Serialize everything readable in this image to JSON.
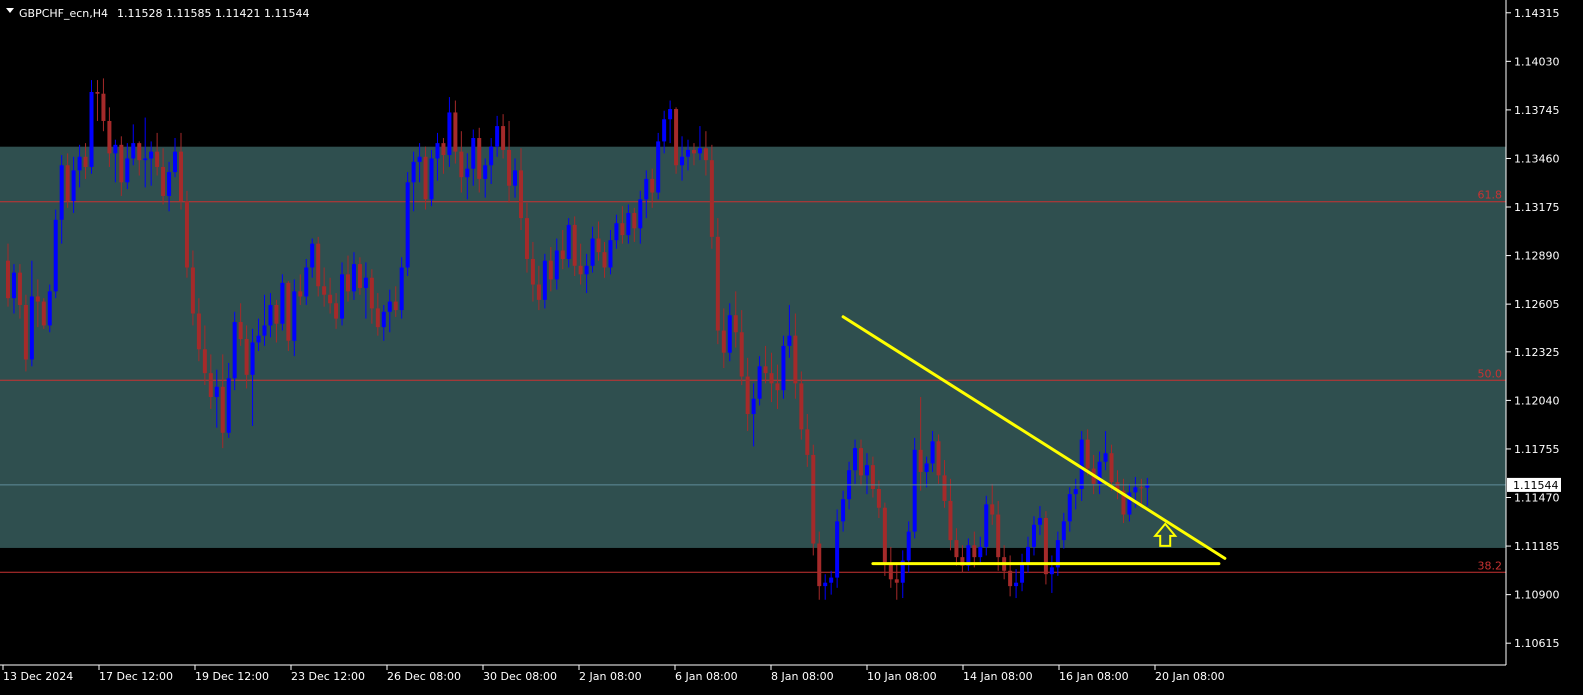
{
  "header": {
    "symbol": "GBPCHF_ecn,H4",
    "ohlc": "1.11528 1.11585 1.11421 1.11544"
  },
  "chart_data": {
    "type": "candlestick",
    "symbol": "GBPCHF_ecn",
    "timeframe": "H4",
    "ohlc_readout": {
      "open": 1.11528,
      "high": 1.11585,
      "low": 1.11421,
      "close": 1.11544
    },
    "current_price": 1.11544,
    "current_price_label": "1.11544",
    "y_range": [
      1.10487,
      1.1439
    ],
    "y_ticks": [
      "1.14315",
      "1.14030",
      "1.13745",
      "1.13460",
      "1.13175",
      "1.12890",
      "1.12605",
      "1.12325",
      "1.12040",
      "1.11755",
      "1.11470",
      "1.11185",
      "1.10900",
      "1.10615"
    ],
    "x_ticks": [
      "13 Dec 2024",
      "17 Dec 12:00",
      "19 Dec 12:00",
      "23 Dec 12:00",
      "26 Dec 08:00",
      "30 Dec 08:00",
      "2 Jan 08:00",
      "6 Jan 08:00",
      "8 Jan 08:00",
      "10 Jan 08:00",
      "14 Jan 08:00",
      "16 Jan 08:00",
      "20 Jan 08:00"
    ],
    "fibonacci_levels": [
      {
        "label": "61.8",
        "price": 1.13206
      },
      {
        "label": "50.0",
        "price": 1.12158
      },
      {
        "label": "38.2",
        "price": 1.11031
      }
    ],
    "shaded_zone": {
      "top": 1.13529,
      "bottom": 1.11174,
      "color": "#2f4f4f"
    },
    "trendlines": [
      {
        "name": "descending resistance",
        "from_bar": 140,
        "from_price": 1.12531,
        "to_bar": 204,
        "to_price": 1.11113,
        "color": "#ffff00"
      },
      {
        "name": "horizontal support",
        "from_bar": 145,
        "from_price": 1.11082,
        "to_bar": 203,
        "to_price": 1.11082,
        "color": "#ffff00"
      }
    ],
    "arrow_marker": {
      "bar": 194,
      "price": 1.11186,
      "direction": "up",
      "color": "#ffff00"
    },
    "colors": {
      "bull": "#0000ff",
      "bear": "#a52a2a",
      "background": "#000000",
      "axis": "#ffffff",
      "fib": "#c83232",
      "current_price_line": "#5f8c9a"
    },
    "candles": [
      [
        1.1286,
        1.1296,
        1.1259,
        1.1264
      ],
      [
        1.1264,
        1.1284,
        1.1255,
        1.1279
      ],
      [
        1.1279,
        1.1284,
        1.1252,
        1.126
      ],
      [
        1.126,
        1.1266,
        1.1221,
        1.1228
      ],
      [
        1.1228,
        1.1286,
        1.1224,
        1.1265
      ],
      [
        1.1265,
        1.1275,
        1.1247,
        1.1262
      ],
      [
        1.1262,
        1.1264,
        1.1246,
        1.1248
      ],
      [
        1.1248,
        1.1272,
        1.1244,
        1.1268
      ],
      [
        1.1268,
        1.1316,
        1.1264,
        1.131
      ],
      [
        1.131,
        1.1348,
        1.1296,
        1.1342
      ],
      [
        1.1342,
        1.1349,
        1.1317,
        1.1321
      ],
      [
        1.1321,
        1.1347,
        1.1314,
        1.1339
      ],
      [
        1.1339,
        1.1354,
        1.1329,
        1.1347
      ],
      [
        1.1347,
        1.1355,
        1.1334,
        1.1341
      ],
      [
        1.1341,
        1.1392,
        1.1337,
        1.1385
      ],
      [
        1.1385,
        1.1392,
        1.1368,
        1.1384
      ],
      [
        1.1384,
        1.1393,
        1.1362,
        1.1368
      ],
      [
        1.1368,
        1.1376,
        1.1341,
        1.1349
      ],
      [
        1.1349,
        1.1357,
        1.1332,
        1.1354
      ],
      [
        1.1354,
        1.1359,
        1.1324,
        1.1332
      ],
      [
        1.1332,
        1.1355,
        1.1328,
        1.1346
      ],
      [
        1.1346,
        1.1366,
        1.1342,
        1.1355
      ],
      [
        1.1355,
        1.1356,
        1.1336,
        1.1345
      ],
      [
        1.1345,
        1.137,
        1.1329,
        1.1346
      ],
      [
        1.1346,
        1.1356,
        1.133,
        1.135
      ],
      [
        1.135,
        1.1361,
        1.1336,
        1.1341
      ],
      [
        1.1341,
        1.1352,
        1.1319,
        1.1324
      ],
      [
        1.1324,
        1.1344,
        1.1315,
        1.1338
      ],
      [
        1.1338,
        1.1358,
        1.1335,
        1.135
      ],
      [
        1.135,
        1.1361,
        1.1316,
        1.1321
      ],
      [
        1.1321,
        1.1327,
        1.1276,
        1.1282
      ],
      [
        1.1282,
        1.1292,
        1.1248,
        1.1255
      ],
      [
        1.1255,
        1.1264,
        1.1227,
        1.1234
      ],
      [
        1.1234,
        1.1248,
        1.1213,
        1.122
      ],
      [
        1.122,
        1.1231,
        1.1199,
        1.1206
      ],
      [
        1.1206,
        1.1222,
        1.1188,
        1.1212
      ],
      [
        1.1212,
        1.1231,
        1.1176,
        1.1185
      ],
      [
        1.1185,
        1.1226,
        1.1182,
        1.1217
      ],
      [
        1.1217,
        1.1256,
        1.121,
        1.125
      ],
      [
        1.125,
        1.1261,
        1.1236,
        1.124
      ],
      [
        1.124,
        1.1248,
        1.1211,
        1.1219
      ],
      [
        1.1219,
        1.1246,
        1.1189,
        1.1238
      ],
      [
        1.1238,
        1.1252,
        1.1233,
        1.1242
      ],
      [
        1.1242,
        1.1266,
        1.1236,
        1.1248
      ],
      [
        1.1248,
        1.1267,
        1.1241,
        1.126
      ],
      [
        1.126,
        1.1263,
        1.1238,
        1.1249
      ],
      [
        1.1249,
        1.1278,
        1.1245,
        1.1273
      ],
      [
        1.1273,
        1.1274,
        1.1233,
        1.1239
      ],
      [
        1.1239,
        1.1275,
        1.123,
        1.1268
      ],
      [
        1.1268,
        1.1278,
        1.126,
        1.1265
      ],
      [
        1.1265,
        1.1287,
        1.126,
        1.1282
      ],
      [
        1.1282,
        1.1299,
        1.1276,
        1.1296
      ],
      [
        1.1296,
        1.13,
        1.1265,
        1.1271
      ],
      [
        1.1271,
        1.1282,
        1.1259,
        1.1266
      ],
      [
        1.1266,
        1.1276,
        1.1255,
        1.1261
      ],
      [
        1.1261,
        1.1267,
        1.1246,
        1.1252
      ],
      [
        1.1252,
        1.1285,
        1.1248,
        1.1278
      ],
      [
        1.1278,
        1.1289,
        1.1262,
        1.1268
      ],
      [
        1.1268,
        1.1291,
        1.1263,
        1.1284
      ],
      [
        1.1284,
        1.1288,
        1.1266,
        1.127
      ],
      [
        1.127,
        1.1285,
        1.1252,
        1.1276
      ],
      [
        1.1276,
        1.1281,
        1.1249,
        1.1258
      ],
      [
        1.1258,
        1.1267,
        1.1242,
        1.1247
      ],
      [
        1.1247,
        1.126,
        1.1239,
        1.1256
      ],
      [
        1.1256,
        1.1269,
        1.1244,
        1.1262
      ],
      [
        1.1262,
        1.1271,
        1.1253,
        1.1257
      ],
      [
        1.1257,
        1.1288,
        1.1252,
        1.1282
      ],
      [
        1.1282,
        1.1338,
        1.1277,
        1.1332
      ],
      [
        1.1332,
        1.135,
        1.1315,
        1.1344
      ],
      [
        1.1344,
        1.1355,
        1.1332,
        1.1347
      ],
      [
        1.1347,
        1.1353,
        1.1316,
        1.1322
      ],
      [
        1.1322,
        1.1351,
        1.1318,
        1.1346
      ],
      [
        1.1346,
        1.1361,
        1.1333,
        1.1355
      ],
      [
        1.1355,
        1.1358,
        1.1337,
        1.1348
      ],
      [
        1.1348,
        1.1382,
        1.1341,
        1.1373
      ],
      [
        1.1373,
        1.138,
        1.1343,
        1.135
      ],
      [
        1.135,
        1.1362,
        1.1326,
        1.1335
      ],
      [
        1.1335,
        1.1349,
        1.1322,
        1.134
      ],
      [
        1.134,
        1.1363,
        1.133,
        1.1358
      ],
      [
        1.1358,
        1.1364,
        1.1326,
        1.1334
      ],
      [
        1.1334,
        1.1346,
        1.1323,
        1.1342
      ],
      [
        1.1342,
        1.1358,
        1.1331,
        1.1353
      ],
      [
        1.1353,
        1.1371,
        1.1347,
        1.1365
      ],
      [
        1.1365,
        1.1372,
        1.1346,
        1.1351
      ],
      [
        1.1351,
        1.1368,
        1.132,
        1.133
      ],
      [
        1.133,
        1.1346,
        1.1323,
        1.1339
      ],
      [
        1.1339,
        1.1352,
        1.1304,
        1.1311
      ],
      [
        1.1311,
        1.132,
        1.1279,
        1.1287
      ],
      [
        1.1287,
        1.1297,
        1.1262,
        1.1272
      ],
      [
        1.1272,
        1.1283,
        1.1257,
        1.1263
      ],
      [
        1.1263,
        1.129,
        1.1258,
        1.1286
      ],
      [
        1.1286,
        1.1294,
        1.1268,
        1.1275
      ],
      [
        1.1275,
        1.1299,
        1.1269,
        1.1292
      ],
      [
        1.1292,
        1.1304,
        1.1281,
        1.1287
      ],
      [
        1.1287,
        1.1311,
        1.1282,
        1.1307
      ],
      [
        1.1307,
        1.1312,
        1.1277,
        1.1283
      ],
      [
        1.1283,
        1.1296,
        1.1272,
        1.1278
      ],
      [
        1.1278,
        1.129,
        1.1267,
        1.1283
      ],
      [
        1.1283,
        1.1306,
        1.1279,
        1.1299
      ],
      [
        1.1299,
        1.1309,
        1.1286,
        1.1291
      ],
      [
        1.1291,
        1.1297,
        1.1276,
        1.1282
      ],
      [
        1.1282,
        1.1304,
        1.1278,
        1.1298
      ],
      [
        1.1298,
        1.1313,
        1.1293,
        1.1308
      ],
      [
        1.1308,
        1.1318,
        1.1296,
        1.1301
      ],
      [
        1.1301,
        1.1319,
        1.1296,
        1.1314
      ],
      [
        1.1314,
        1.1317,
        1.1297,
        1.1305
      ],
      [
        1.1305,
        1.1327,
        1.1296,
        1.1322
      ],
      [
        1.1322,
        1.1339,
        1.1311,
        1.1334
      ],
      [
        1.1334,
        1.134,
        1.1317,
        1.1326
      ],
      [
        1.1326,
        1.1361,
        1.1322,
        1.1356
      ],
      [
        1.1356,
        1.1374,
        1.1349,
        1.1369
      ],
      [
        1.1369,
        1.138,
        1.1355,
        1.1375
      ],
      [
        1.1375,
        1.1376,
        1.1337,
        1.1342
      ],
      [
        1.1342,
        1.1359,
        1.1333,
        1.1347
      ],
      [
        1.1347,
        1.1357,
        1.1339,
        1.1351
      ],
      [
        1.1351,
        1.1355,
        1.1342,
        1.1349
      ],
      [
        1.1349,
        1.1365,
        1.1345,
        1.1352
      ],
      [
        1.1352,
        1.1362,
        1.1336,
        1.1345
      ],
      [
        1.1345,
        1.1354,
        1.1293,
        1.13
      ],
      [
        1.13,
        1.1311,
        1.1237,
        1.1245
      ],
      [
        1.1245,
        1.1258,
        1.1223,
        1.1232
      ],
      [
        1.1232,
        1.1261,
        1.1227,
        1.1254
      ],
      [
        1.1254,
        1.1268,
        1.1235,
        1.1244
      ],
      [
        1.1244,
        1.1257,
        1.1213,
        1.1218
      ],
      [
        1.1218,
        1.1229,
        1.1186,
        1.1196
      ],
      [
        1.1196,
        1.1214,
        1.1177,
        1.1205
      ],
      [
        1.1205,
        1.123,
        1.1201,
        1.1224
      ],
      [
        1.1224,
        1.1236,
        1.1214,
        1.122
      ],
      [
        1.122,
        1.1232,
        1.1203,
        1.1214
      ],
      [
        1.1214,
        1.1225,
        1.1199,
        1.121
      ],
      [
        1.121,
        1.1242,
        1.1205,
        1.1236
      ],
      [
        1.1236,
        1.126,
        1.1229,
        1.1242
      ],
      [
        1.1242,
        1.1255,
        1.1205,
        1.1214
      ],
      [
        1.1214,
        1.1221,
        1.1181,
        1.1187
      ],
      [
        1.1187,
        1.1196,
        1.1165,
        1.1172
      ],
      [
        1.1172,
        1.1178,
        1.1113,
        1.112
      ],
      [
        1.112,
        1.1127,
        1.1087,
        1.1095
      ],
      [
        1.1095,
        1.1102,
        1.1087,
        1.1097
      ],
      [
        1.1097,
        1.1104,
        1.109,
        1.11
      ],
      [
        1.11,
        1.114,
        1.1094,
        1.1133
      ],
      [
        1.1133,
        1.1151,
        1.1127,
        1.1146
      ],
      [
        1.1146,
        1.1168,
        1.114,
        1.1163
      ],
      [
        1.1163,
        1.1181,
        1.1155,
        1.1176
      ],
      [
        1.1176,
        1.1181,
        1.1154,
        1.116
      ],
      [
        1.116,
        1.1173,
        1.1149,
        1.1166
      ],
      [
        1.1166,
        1.1171,
        1.1147,
        1.1152
      ],
      [
        1.1152,
        1.1157,
        1.1135,
        1.1141
      ],
      [
        1.1141,
        1.1144,
        1.1101,
        1.1108
      ],
      [
        1.1108,
        1.1118,
        1.1094,
        1.1099
      ],
      [
        1.1099,
        1.1109,
        1.1087,
        1.1097
      ],
      [
        1.1097,
        1.1116,
        1.1088,
        1.111
      ],
      [
        1.111,
        1.1133,
        1.1103,
        1.1127
      ],
      [
        1.1127,
        1.1182,
        1.1123,
        1.1175
      ],
      [
        1.1175,
        1.1206,
        1.1151,
        1.1162
      ],
      [
        1.1162,
        1.1171,
        1.1153,
        1.1167
      ],
      [
        1.1167,
        1.1186,
        1.1162,
        1.118
      ],
      [
        1.118,
        1.1184,
        1.1155,
        1.116
      ],
      [
        1.116,
        1.1169,
        1.1141,
        1.1145
      ],
      [
        1.1145,
        1.1158,
        1.1116,
        1.1122
      ],
      [
        1.1122,
        1.1129,
        1.1107,
        1.1112
      ],
      [
        1.1112,
        1.1119,
        1.1103,
        1.1107
      ],
      [
        1.1107,
        1.1123,
        1.1104,
        1.1119
      ],
      [
        1.1119,
        1.1127,
        1.1106,
        1.1112
      ],
      [
        1.1112,
        1.1124,
        1.1108,
        1.1118
      ],
      [
        1.1118,
        1.1148,
        1.1113,
        1.1143
      ],
      [
        1.1143,
        1.1155,
        1.1131,
        1.1137
      ],
      [
        1.1137,
        1.1145,
        1.1104,
        1.1112
      ],
      [
        1.1112,
        1.1119,
        1.1099,
        1.1104
      ],
      [
        1.1104,
        1.1113,
        1.1089,
        1.1095
      ],
      [
        1.1095,
        1.1105,
        1.1088,
        1.1097
      ],
      [
        1.1097,
        1.1114,
        1.1092,
        1.1108
      ],
      [
        1.1108,
        1.1124,
        1.1103,
        1.1118
      ],
      [
        1.1118,
        1.1136,
        1.1113,
        1.1131
      ],
      [
        1.1131,
        1.1142,
        1.1125,
        1.1135
      ],
      [
        1.1135,
        1.1139,
        1.1096,
        1.1102
      ],
      [
        1.1102,
        1.1113,
        1.1091,
        1.1106
      ],
      [
        1.1106,
        1.1127,
        1.1101,
        1.1122
      ],
      [
        1.1122,
        1.1138,
        1.1117,
        1.1133
      ],
      [
        1.1133,
        1.1153,
        1.1127,
        1.1149
      ],
      [
        1.1149,
        1.1158,
        1.114,
        1.1152
      ],
      [
        1.1152,
        1.1186,
        1.1145,
        1.1181
      ],
      [
        1.1181,
        1.1187,
        1.116,
        1.1164
      ],
      [
        1.1164,
        1.1172,
        1.1149,
        1.1155
      ],
      [
        1.1155,
        1.1174,
        1.1149,
        1.1168
      ],
      [
        1.1168,
        1.1186,
        1.1163,
        1.1173
      ],
      [
        1.1173,
        1.1178,
        1.1151,
        1.1156
      ],
      [
        1.1156,
        1.1163,
        1.1146,
        1.1151
      ],
      [
        1.1151,
        1.1158,
        1.1132,
        1.1137
      ],
      [
        1.1137,
        1.1155,
        1.1133,
        1.115
      ],
      [
        1.115,
        1.1159,
        1.1141,
        1.1153
      ],
      [
        1.1153,
        1.1158,
        1.1142,
        1.11528
      ],
      [
        1.11528,
        1.11585,
        1.11421,
        1.11544
      ]
    ]
  }
}
